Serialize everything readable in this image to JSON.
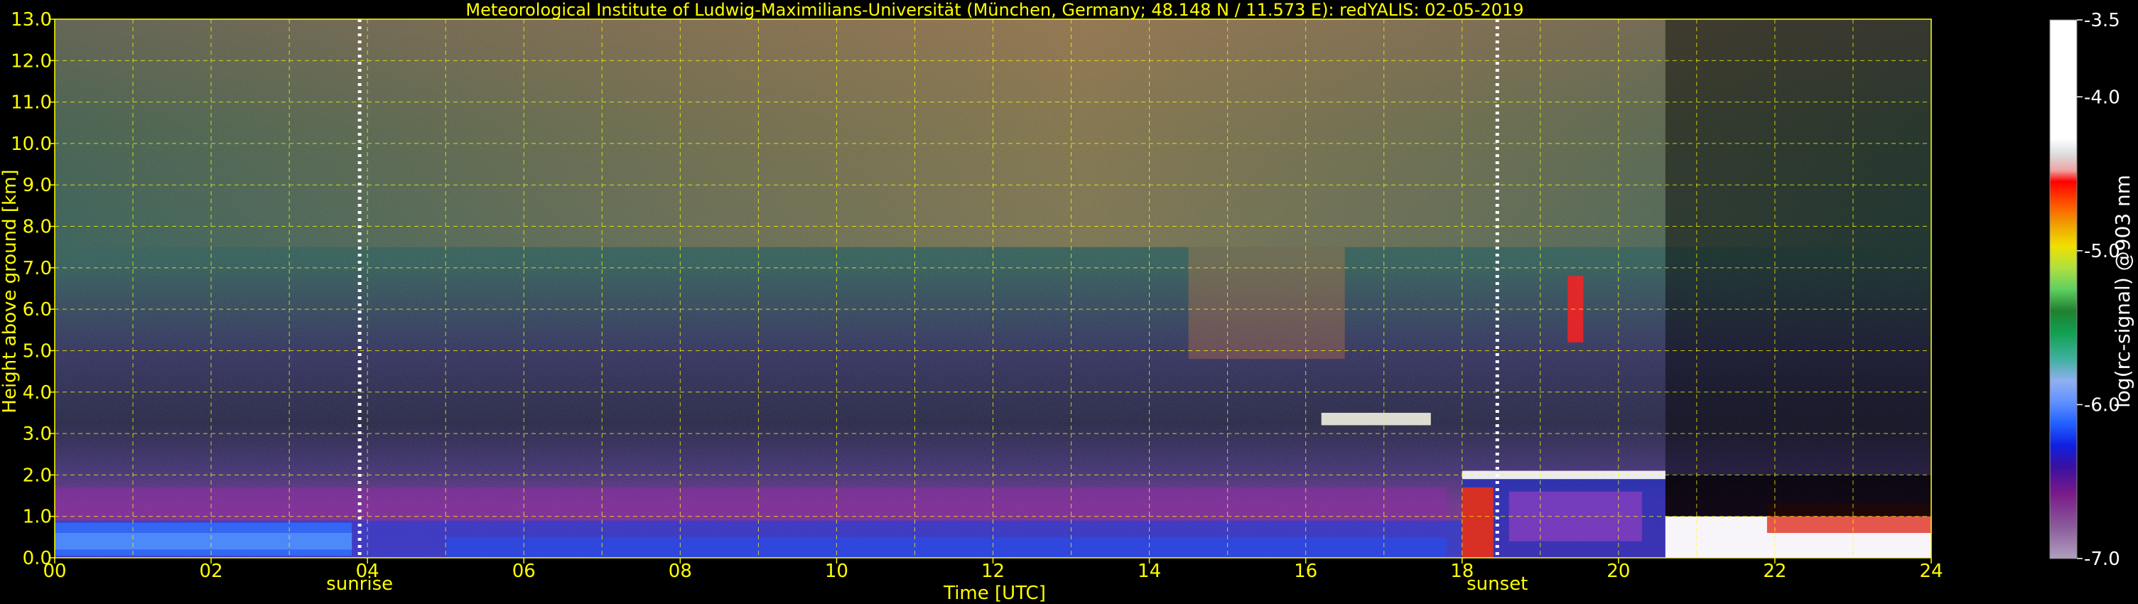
{
  "chart_data": {
    "type": "heatmap",
    "title": "Meteorological Institute of Ludwig-Maximilians-Universität (München, Germany; 48.148 N / 11.573 E):    redYALIS: 02-05-2019",
    "xlabel": "Time [UTC]",
    "ylabel": "Height above ground [km]",
    "colorbar_label": "log(rc-signal) @903 nm",
    "xlim": [
      0,
      24
    ],
    "ylim": [
      0,
      13
    ],
    "x_ticks": [
      "00",
      "02",
      "04",
      "06",
      "08",
      "10",
      "12",
      "14",
      "16",
      "18",
      "20",
      "22",
      "24"
    ],
    "y_ticks": [
      "0.0",
      "1.0",
      "2.0",
      "3.0",
      "4.0",
      "5.0",
      "6.0",
      "7.0",
      "8.0",
      "9.0",
      "10.0",
      "11.0",
      "12.0",
      "13.0"
    ],
    "colorbar_range": [
      -7.0,
      -3.5
    ],
    "colorbar_ticks": [
      "-3.5",
      "-4.0",
      "-5.0",
      "-6.0",
      "-7.0"
    ],
    "grid": true,
    "markers": [
      {
        "label": "sunrise",
        "time": 3.9
      },
      {
        "label": "sunset",
        "time": 18.45
      }
    ],
    "colors": {
      "text": "#ffff00",
      "grid": "#ffff00",
      "marker": "#ffffff",
      "colorbar_label": "#ffffff"
    }
  }
}
